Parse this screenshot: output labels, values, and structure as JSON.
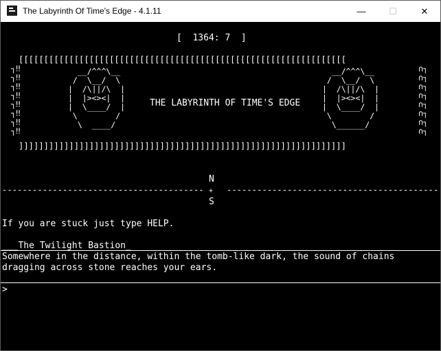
{
  "window": {
    "title": "The Labyrinth Of Time's Edge - 4.1.11",
    "controls": {
      "minimize": "—",
      "maximize": "☐",
      "close": "✕"
    }
  },
  "status": {
    "counter": "[  1364: 7  ]"
  },
  "banner": {
    "top_border": "[[[[[[[[[[[[[[[[[[[[[[[[[[[[[[[[[[[[[[[[[[[[[[[[[[[[[[[[[[[[[[[[[",
    "bottom_border": "]]]]]]]]]]]]]]]]]]]]]]]]]]]]]]]]]]]]]]]]]]]]]]]]]]]]]]]]]]]]]]]]]",
    "left_edge": "┐‼\n┐‼\n┐‼\n┐‼\n┐‼\n┐‼\n┐‼\n┐‼",
    "right_edge": "∩┐\n∩┐\n∩┐\n∩┐\n∩┐\n∩┐\n∩┐\n∩┐",
    "left_face": "  __/^^^\\__\n /  \\__/  \\\n|  /\\||/\\  |\n|  |><><|  |\n|  \\____/  |\n \\        /\n  \\  ____/",
    "right_face": "  __/^^^\\__\n /  \\__/  \\\n|  /\\||/\\  |\n|  |><><|  |\n|  \\____/  |\n \\        /\n  \\______/",
    "title": "THE LABYRINTH OF TIME'S EDGE"
  },
  "compass": {
    "line": "----------------------------------------",
    "north": "N",
    "center": "+",
    "south": "S",
    "right_line": "------------------------------------------"
  },
  "messages": {
    "help_hint": "If you are stuck just type HELP.",
    "location": "___The Twilight Bastion_",
    "description_line1": "Somewhere in the distance, within the tomb-like dark, the sound of chains",
    "description_line2": "dragging across stone reaches your ears."
  },
  "input": {
    "prompt": ">",
    "value": ""
  }
}
